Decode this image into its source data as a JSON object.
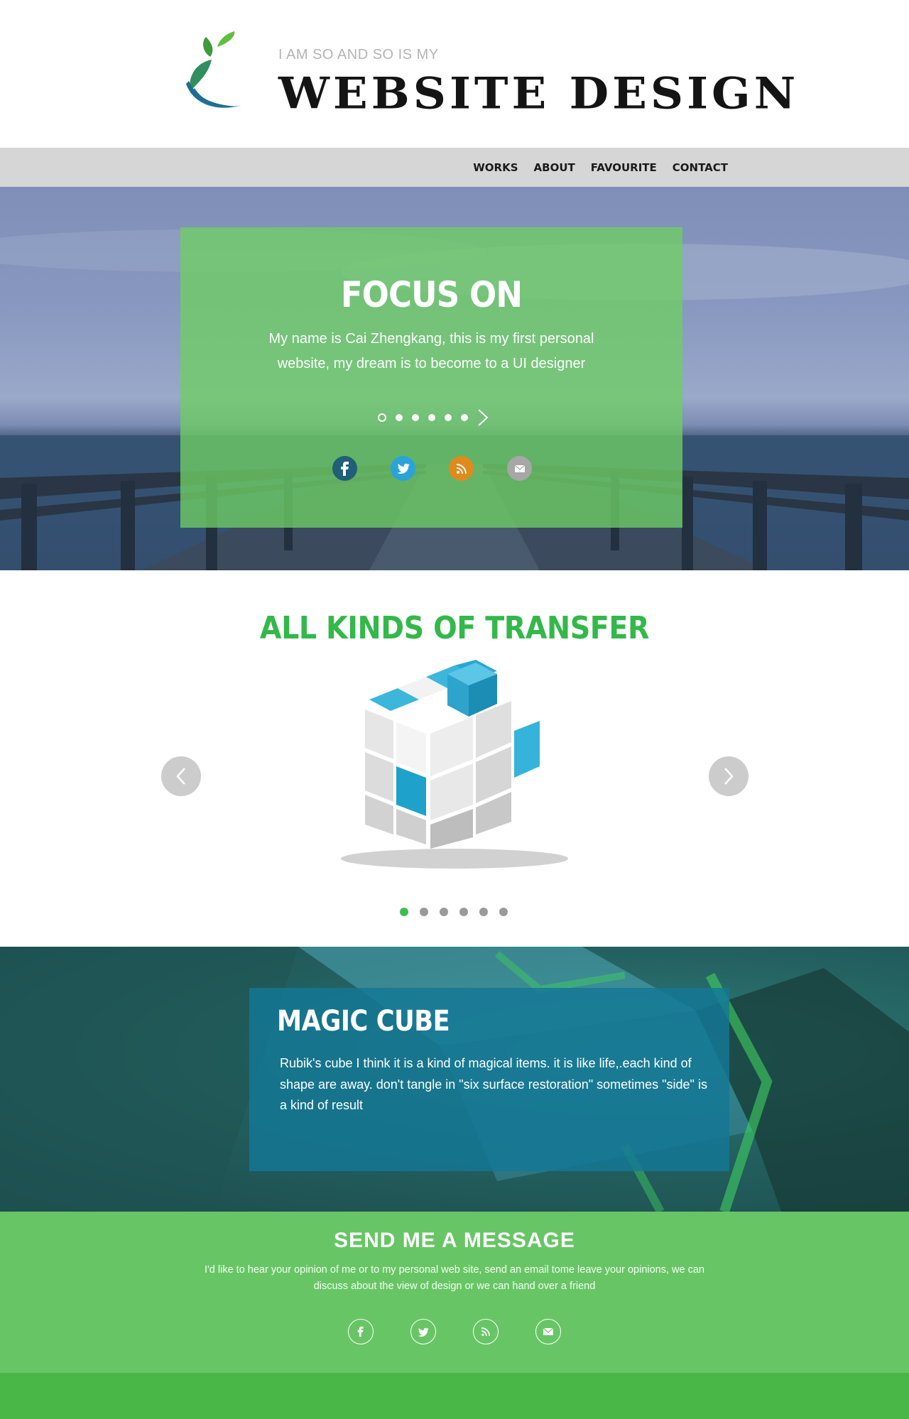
{
  "header": {
    "tagline": "I AM SO AND SO IS MY",
    "title": "WEBSITE DESIGN"
  },
  "nav": {
    "items": [
      {
        "label": "WORKS"
      },
      {
        "label": "ABOUT"
      },
      {
        "label": "FAVOURITE"
      },
      {
        "label": "CONTACT"
      }
    ]
  },
  "hero": {
    "title": "FOCUS ON",
    "text": "My name is Cai Zhengkang, this is my first personal website, my dream is to become to a UI designer",
    "slides_total": 6,
    "active_slide": 1,
    "social": [
      {
        "icon": "facebook-icon",
        "glyph": "f",
        "color": "#1f5f77"
      },
      {
        "icon": "twitter-icon",
        "glyph": "t",
        "color": "#2aa4d8"
      },
      {
        "icon": "rss-icon",
        "glyph": "rss",
        "color": "#e08a1c"
      },
      {
        "icon": "mail-icon",
        "glyph": "mail",
        "color": "#a7a7a7"
      }
    ]
  },
  "transfer": {
    "title": "ALL KINDS OF TRANSFER",
    "slides_total": 6,
    "active_slide": 1
  },
  "magic": {
    "title": "MAGIC CUBE",
    "text": "Rubik's cube I think it is a kind of magical items. it is like life,.each kind of shape are away. don't tangle in \"six surface restoration\" sometimes \"side\" is a kind of result"
  },
  "contact": {
    "title": "SEND ME A MESSAGE",
    "text": "I'd like to hear your opinion of me or to my personal web site, send an email tome leave your opinions, we can discuss about the view of design or we can hand over a friend"
  },
  "colors": {
    "accent_green": "#33b84a",
    "hero_overlay": "#6ece64",
    "magic_overlay": "#137896",
    "contact_bg": "#68c566",
    "footer_bg": "#49b748"
  }
}
